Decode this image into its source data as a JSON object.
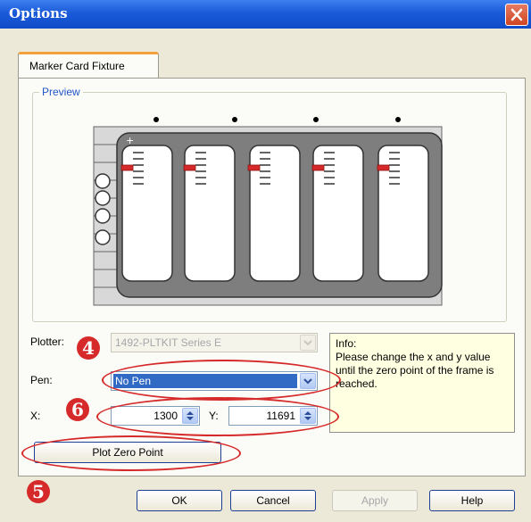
{
  "window": {
    "title": "Options"
  },
  "tabs": [
    {
      "label": "Marker Card Fixture",
      "active": true
    }
  ],
  "preview": {
    "legend": "Preview",
    "cards": 5,
    "holes": 4,
    "first_card_mark": "+"
  },
  "form": {
    "plotter_label": "Plotter:",
    "plotter_value": "1492-PLTKIT Series E",
    "pen_label": "Pen:",
    "pen_value": "No Pen",
    "x_label": "X:",
    "x_value": "1300",
    "y_label": "Y:",
    "y_value": "11691",
    "plot_zero_label": "Plot Zero Point"
  },
  "info": {
    "heading": "Info:",
    "text": "Please change the x and y value until the zero point of the frame is reached."
  },
  "callouts": [
    "4",
    "6",
    "5"
  ],
  "footer": {
    "ok": "OK",
    "cancel": "Cancel",
    "apply": "Apply",
    "help": "Help"
  },
  "colors": {
    "titlebar": "#1a5ad8",
    "callout": "#d62a2a",
    "selection": "#316ac5",
    "info_bg": "#ffffe1",
    "tab_accent": "#f2a13b"
  }
}
